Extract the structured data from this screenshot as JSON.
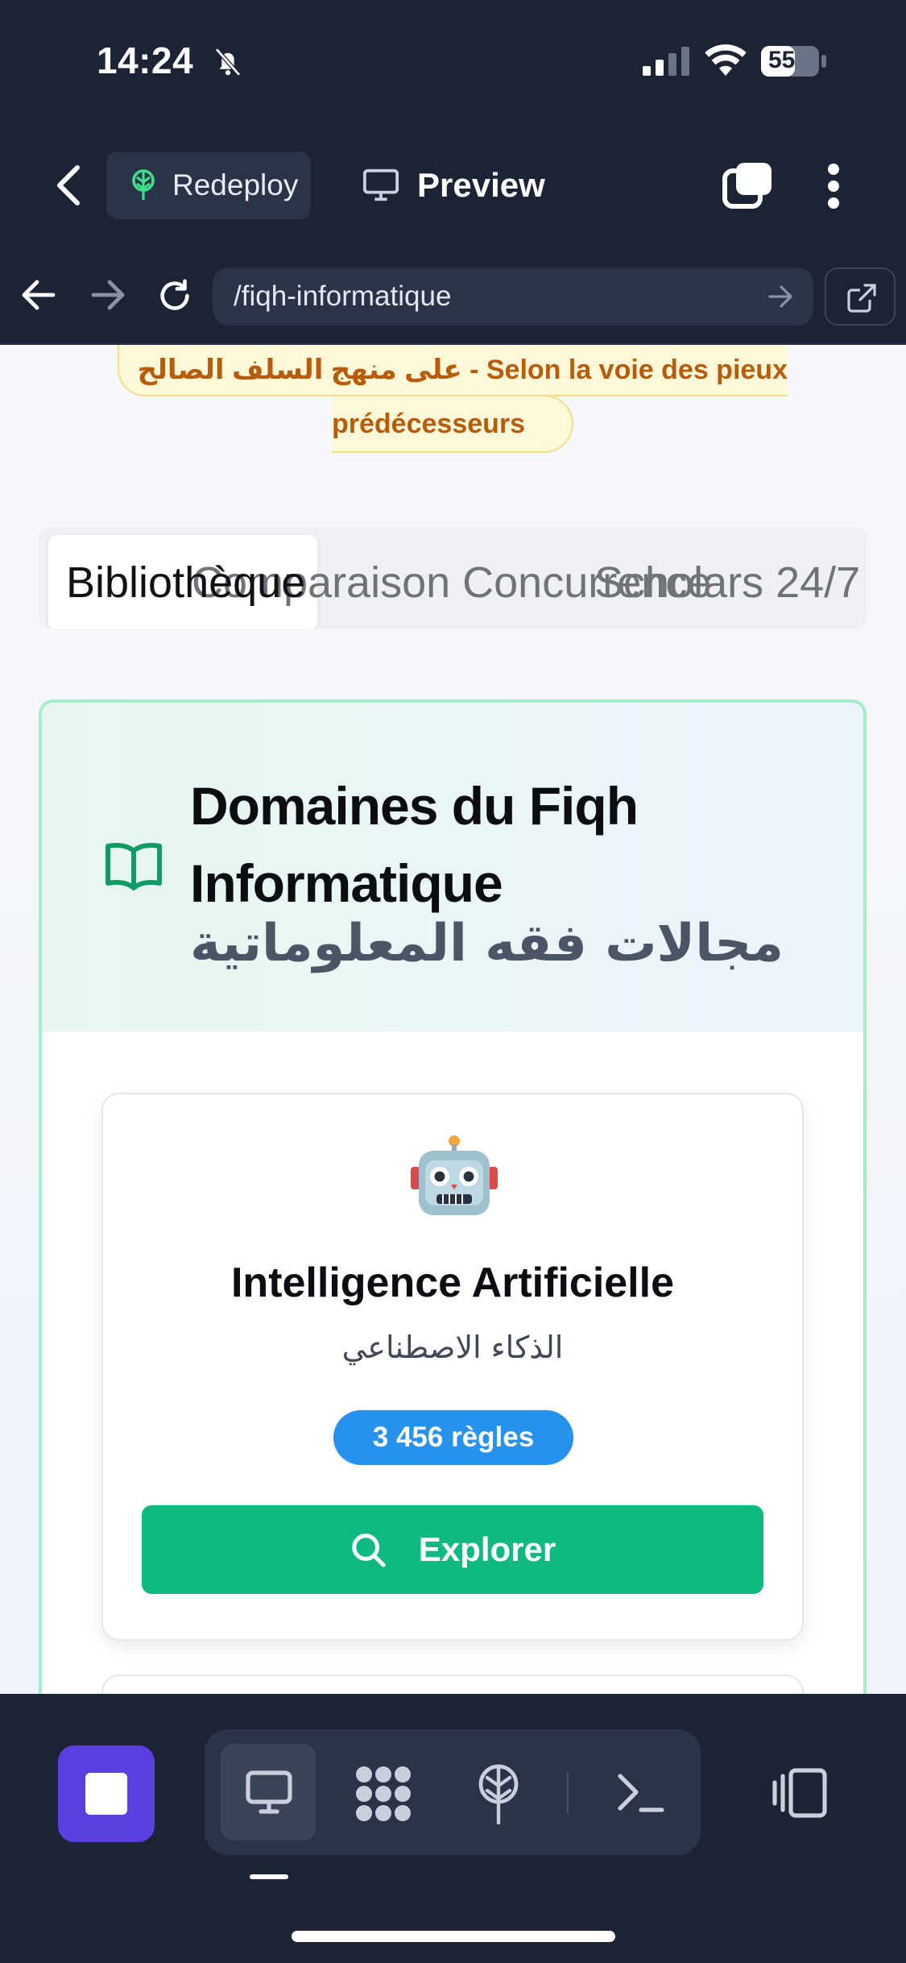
{
  "status_bar": {
    "time": "14:24",
    "battery": "55"
  },
  "app_toolbar": {
    "redeploy_label": "Redeploy",
    "preview_label": "Preview"
  },
  "browser": {
    "url": "/fiqh-informatique"
  },
  "page": {
    "banner_line1": "على منهج السلف الصالح - Selon la voie des pieux",
    "banner_line2": "prédécesseurs",
    "tabs": [
      {
        "label": "Bibliothèque",
        "active": true
      },
      {
        "label": "Comparaison Concurrence",
        "active": false
      },
      {
        "label": "Scholars 24/7",
        "active": false
      }
    ],
    "domains": {
      "title": "Domaines du Fiqh Informatique",
      "subtitle": "مجالات فقه المعلوماتية",
      "cards": [
        {
          "icon": "robot-icon",
          "title": "Intelligence Artificielle",
          "subtitle": "الذكاء الاصطناعي",
          "badge": "3 456 règles",
          "button": "Explorer"
        }
      ]
    }
  },
  "colors": {
    "chrome_bg": "#1c2334",
    "banner_text": "#b85c0b",
    "badge_blue": "#2791f0",
    "explore_green": "#10b97d",
    "stop_purple": "#5b3ee0"
  }
}
